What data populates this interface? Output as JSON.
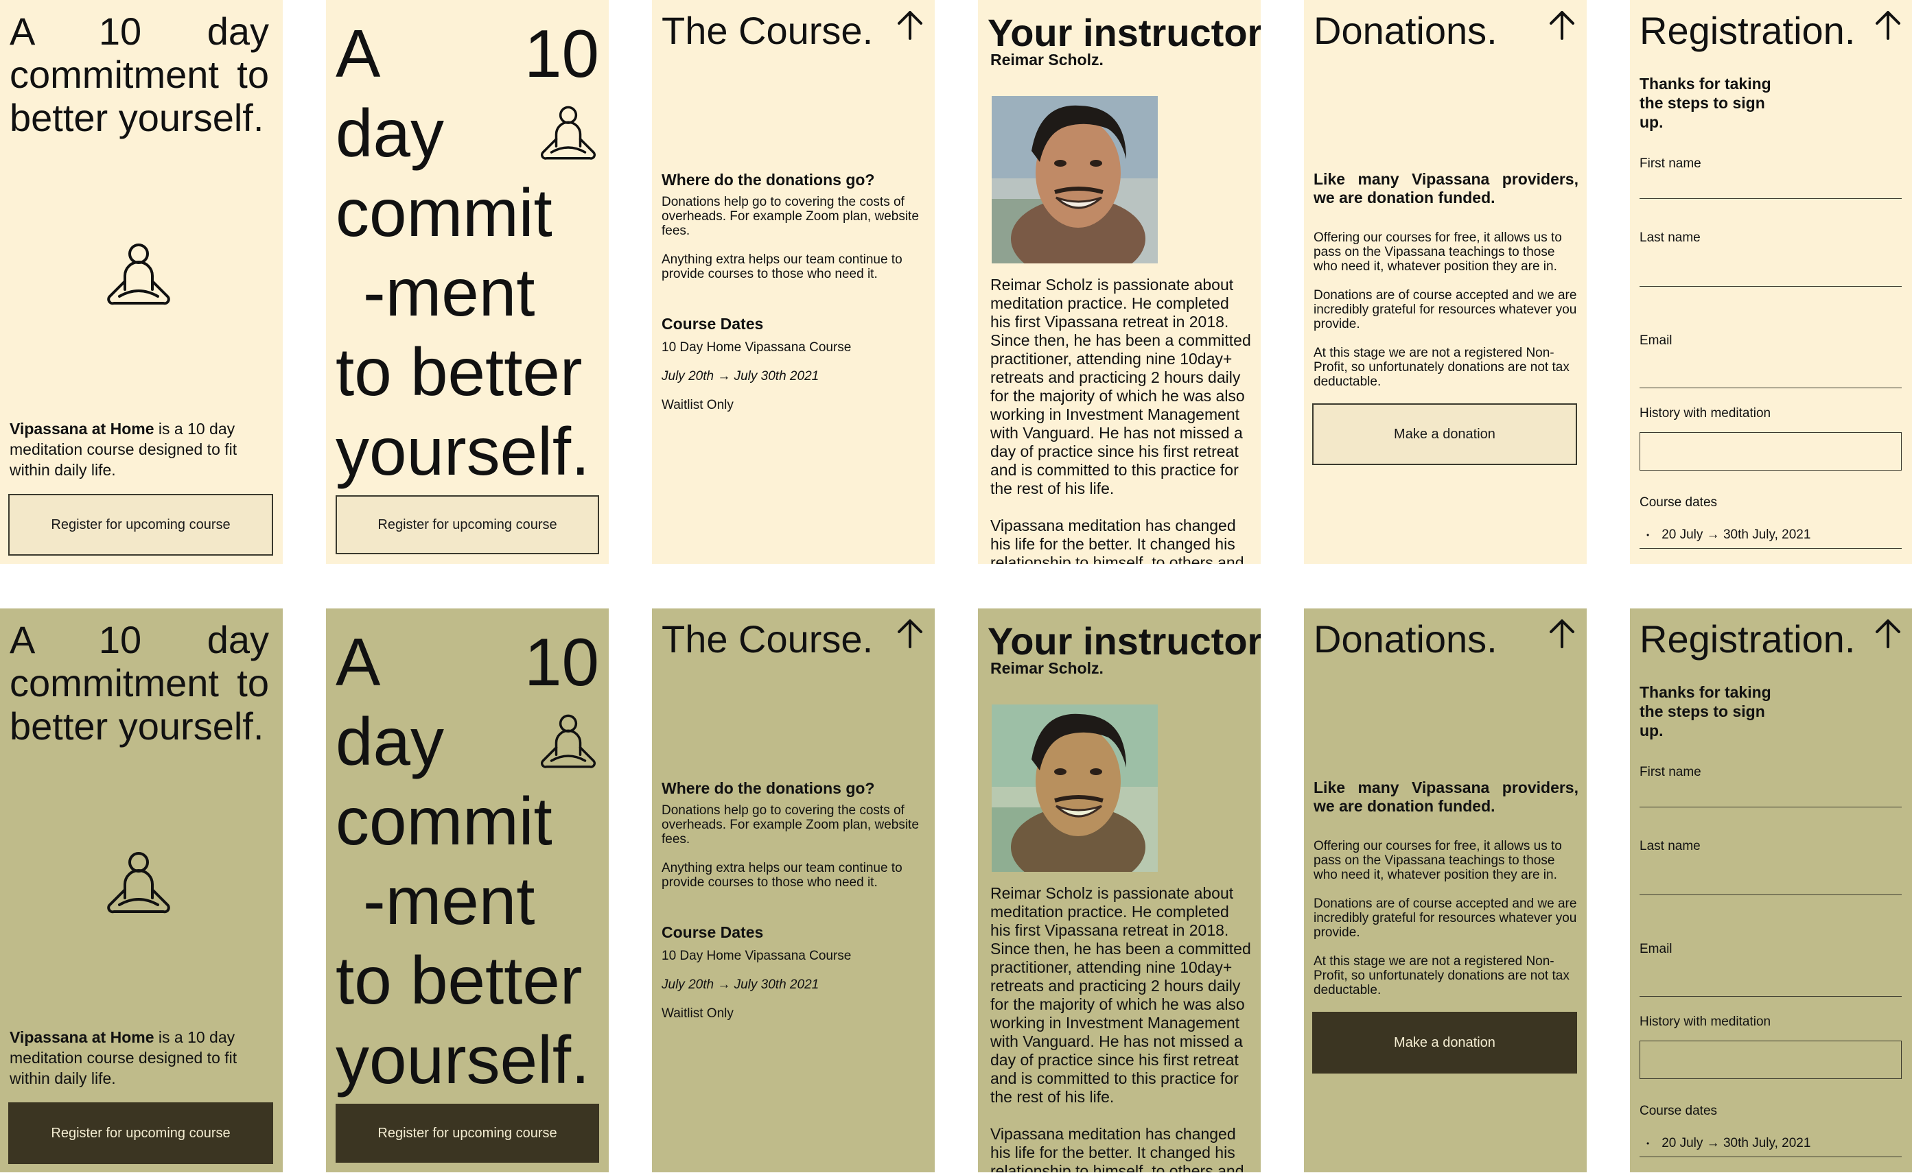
{
  "hero": {
    "title": "A 10 day commitment to better yourself.",
    "big_lines": [
      "A",
      "10",
      "day",
      "commit",
      "-ment",
      "to better",
      "yourself."
    ],
    "blurb_bold": "Vipassana at Home",
    "blurb_rest": " is a 10 day meditation course designed to fit within daily life.",
    "register_label": "Register for upcoming course",
    "icon": "meditation-person-icon"
  },
  "course": {
    "title": "The Course.",
    "donations_heading": "Where do the donations go?",
    "donations_p1": "Donations help go to covering the costs of overheads. For example Zoom plan, website fees.",
    "donations_p2": "Anything extra helps our team continue to provide courses to those who need it.",
    "dates_heading": "Course Dates",
    "course_name": "10 Day Home Vipassana Course",
    "course_dates": "July 20th → July 30th 2021",
    "availability": "Waitlist Only",
    "arrow_icon": "arrow-up-icon"
  },
  "instructor": {
    "title": "Your instructor.",
    "name": "Reimar Scholz.",
    "bio_p1": "Reimar Scholz is passionate about meditation practice. He completed his first Vipassana retreat in 2018. Since then, he has been a committed practitioner, attending nine 10day+ retreats and practicing 2 hours daily for the majority of which he was also working in Investment Management with Vanguard. He has not missed a day of practice since his first retreat and is committed to this practice for the rest of his life.",
    "bio_p2": "Vipassana meditation has changed his life for the better. It changed his relationship to himself, to others and"
  },
  "donations": {
    "title": "Donations.",
    "lead": "Like many Vipassana providers, we are donation funded.",
    "p1": "Offering our courses for free, it allows us to pass on the Vipassana teachings to those who need it, whatever position they are in.",
    "p2": "Donations are of course accepted and we are incredibly grateful for resources whatever you provide.",
    "p3": "At this stage we are not a registered Non-Profit, so unfortunately donations are not tax deductable.",
    "button_label": "Make a donation"
  },
  "registration": {
    "title": "Registration.",
    "thanks": "Thanks for taking the steps to sign up.",
    "first_name_label": "First name",
    "last_name_label": "Last name",
    "email_label": "Email",
    "history_label": "History with meditation",
    "course_dates_label": "Course dates",
    "course_dates_value": "20 July → 30th July, 2021"
  },
  "themes": {
    "cream": {
      "background": "#fdf2d6",
      "button_bg": "#f3e8c9",
      "button_border": "#3b3a2e"
    },
    "olive": {
      "background": "#bfbb8a",
      "button_bg": "#3b3522",
      "button_text": "#f3ecd1"
    }
  }
}
